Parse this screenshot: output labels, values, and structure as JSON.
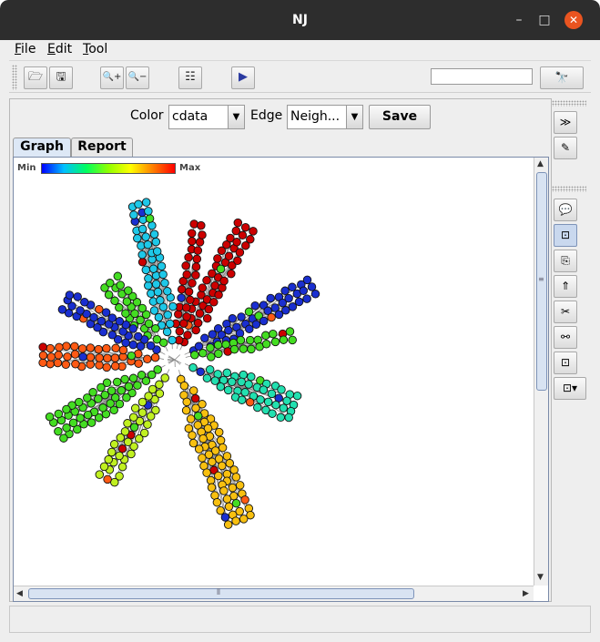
{
  "window": {
    "title": "NJ",
    "minimize_icon": "–",
    "maximize_icon": "□",
    "close_icon": "✕"
  },
  "menu": [
    "File",
    "Edit",
    "Tool"
  ],
  "toolbar": {
    "open": "🗁",
    "save": "🖫",
    "zoom_in": "🔍+",
    "zoom_out": "🔍−",
    "layout": "☷",
    "run": "▶",
    "search_value": "",
    "find": "🔭"
  },
  "controls": {
    "color_label": "Color",
    "color_value": "cdata",
    "edge_label": "Edge",
    "edge_value": "Neigh...",
    "save_label": "Save",
    "dropdown_arrow": "▼"
  },
  "tabs": [
    {
      "label": "Graph",
      "active": true
    },
    {
      "label": "Report",
      "active": false
    }
  ],
  "legend": {
    "min": "Min",
    "max": "Max"
  },
  "scroll": {
    "up": "▲",
    "down": "▼",
    "left": "◀",
    "right": "▶",
    "grip_v": "≡",
    "grip_h": "⦀"
  },
  "side_tools": [
    "≫",
    "✎",
    "💬",
    "⊡",
    "⎘",
    "⇑",
    "✂",
    "⚯",
    "⊡",
    "⊡▾"
  ],
  "status": "",
  "colors": {
    "red": "#cc0000",
    "blue": "#1a2fd0",
    "cyan": "#1ec8e8",
    "green": "#44dd22",
    "orange": "#ff5a14",
    "teal": "#22e0b0",
    "lime": "#c0f020",
    "yellow": "#f8c010",
    "accent": "#e95420"
  },
  "graph": {
    "center": [
      177,
      222
    ],
    "branches": [
      {
        "color": "red",
        "angle": -62,
        "len": 165,
        "width": 3
      },
      {
        "color": "red",
        "angle": -80,
        "len": 150,
        "width": 2
      },
      {
        "color": "cyan",
        "angle": -103,
        "len": 175,
        "width": 3
      },
      {
        "color": "green",
        "angle": -130,
        "len": 110,
        "width": 3
      },
      {
        "color": "blue",
        "angle": -152,
        "len": 135,
        "width": 3
      },
      {
        "color": "blue",
        "angle": -28,
        "len": 170,
        "width": 3
      },
      {
        "color": "green",
        "angle": -12,
        "len": 130,
        "width": 2
      },
      {
        "color": "orange",
        "angle": -178,
        "len": 145,
        "width": 3
      },
      {
        "color": "green",
        "angle": 150,
        "len": 150,
        "width": 4
      },
      {
        "color": "lime",
        "angle": 120,
        "len": 150,
        "width": 3
      },
      {
        "color": "yellow",
        "angle": 68,
        "len": 190,
        "width": 4
      },
      {
        "color": "teal",
        "angle": 22,
        "len": 140,
        "width": 4
      }
    ]
  }
}
